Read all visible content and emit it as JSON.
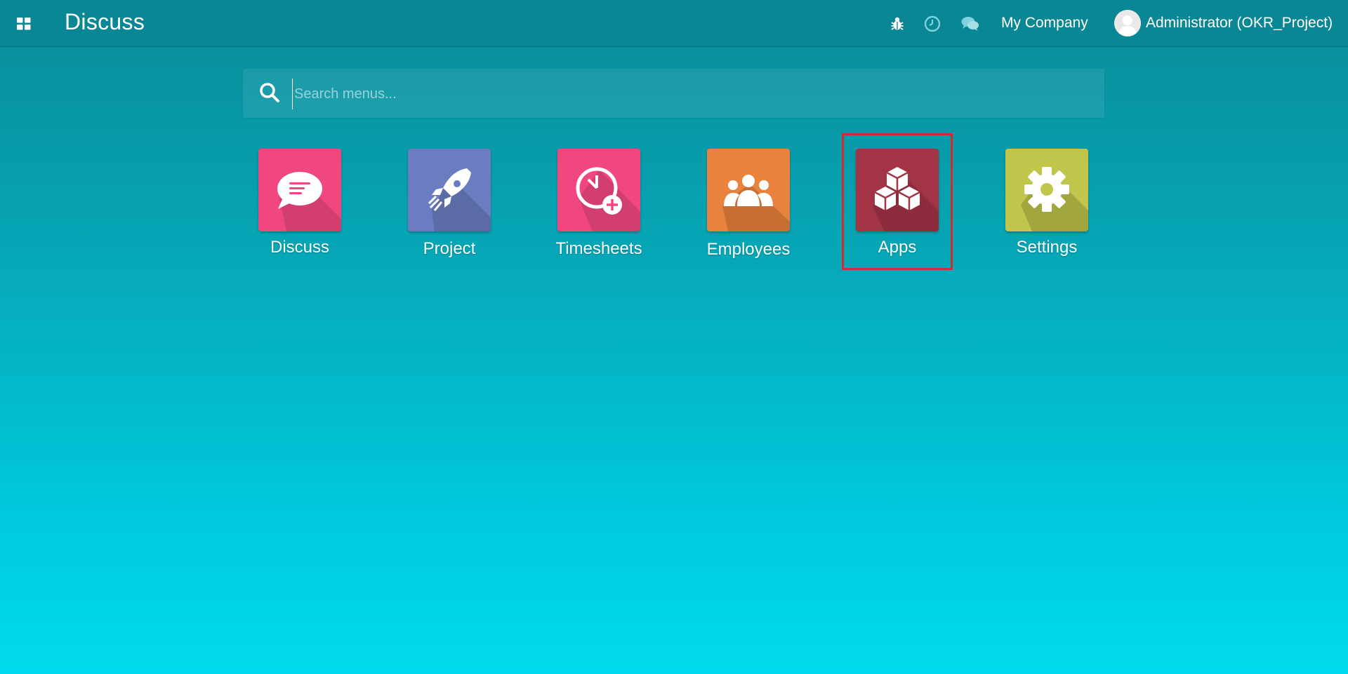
{
  "topbar": {
    "title": "Discuss",
    "company": "My Company",
    "user": "Administrator (OKR_Project)"
  },
  "search": {
    "placeholder": "Search menus..."
  },
  "apps": [
    {
      "label": "Discuss",
      "color": "#f0477f",
      "icon": "chat-bubble-icon"
    },
    {
      "label": "Project",
      "color": "#6b7dc0",
      "icon": "rocket-icon"
    },
    {
      "label": "Timesheets",
      "color": "#f0477f",
      "icon": "clock-plus-icon"
    },
    {
      "label": "Employees",
      "color": "#e8823c",
      "icon": "people-icon"
    },
    {
      "label": "Apps",
      "color": "#a33446",
      "icon": "cubes-icon"
    },
    {
      "label": "Settings",
      "color": "#c0c64b",
      "icon": "gear-icon"
    }
  ],
  "highlighted_app": "Apps",
  "colors": {
    "topbar": "#0a8794",
    "background_top": "#0a8a97",
    "background_bottom": "#00dbee",
    "highlight": "#d12b2b"
  }
}
